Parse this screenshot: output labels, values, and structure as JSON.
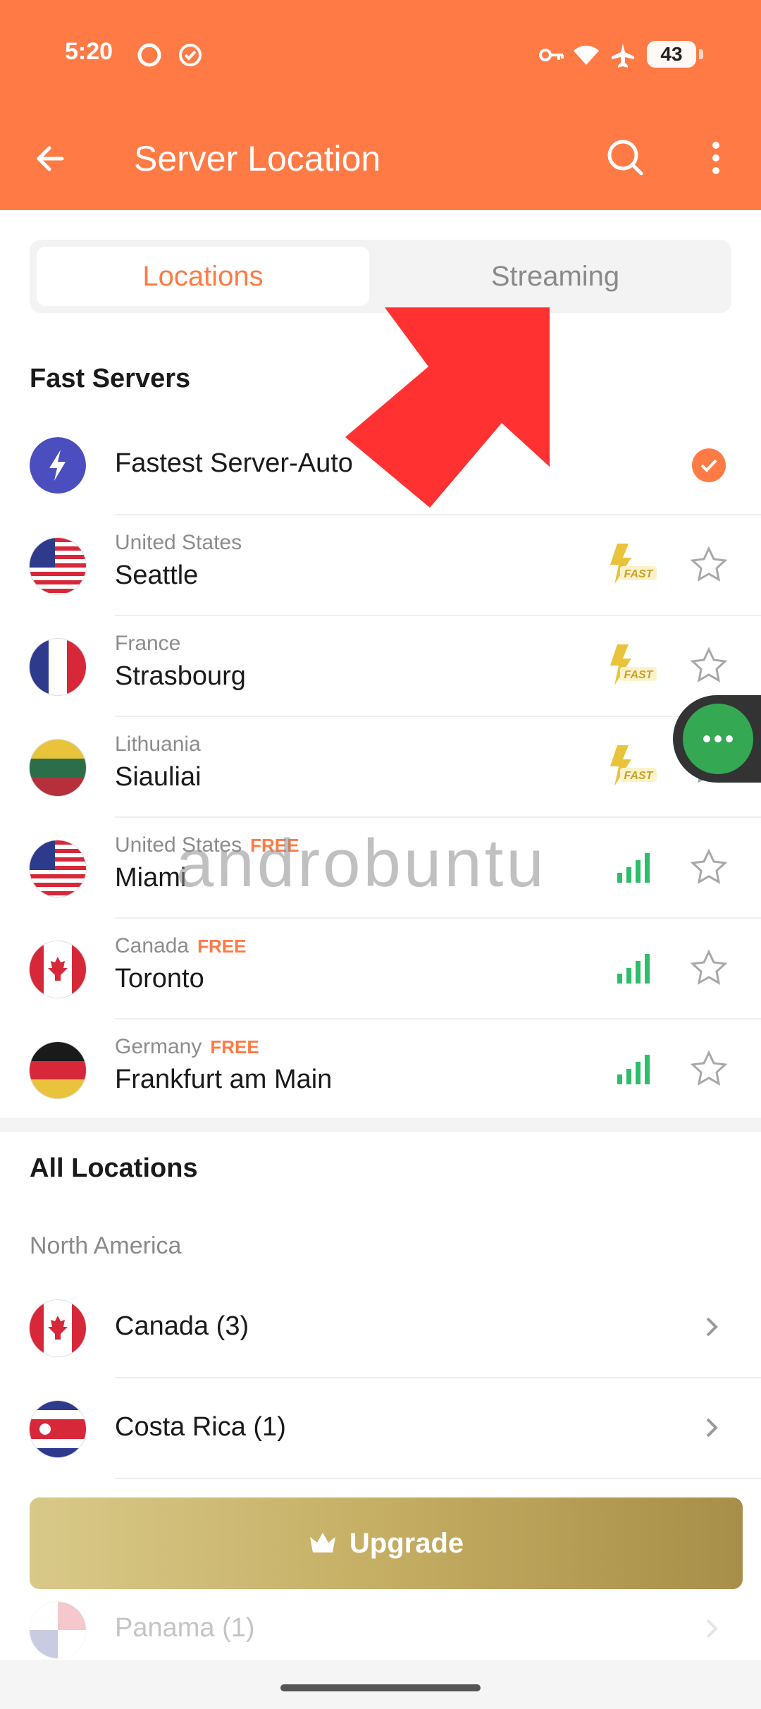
{
  "status_bar": {
    "time": "5:20",
    "battery": "43"
  },
  "header": {
    "title": "Server Location"
  },
  "tabs": [
    {
      "label": "Locations"
    },
    {
      "label": "Streaming"
    }
  ],
  "fast_servers": {
    "title": "Fast Servers",
    "auto": {
      "label": "Fastest Server-Auto"
    },
    "items": [
      {
        "country": "United States",
        "city": "Seattle",
        "free": ""
      },
      {
        "country": "France",
        "city": "Strasbourg",
        "free": ""
      },
      {
        "country": "Lithuania",
        "city": "Siauliai",
        "free": ""
      },
      {
        "country": "United States",
        "city": "Miami",
        "free": "FREE"
      },
      {
        "country": "Canada",
        "city": "Toronto",
        "free": "FREE"
      },
      {
        "country": "Germany",
        "city": "Frankfurt am Main",
        "free": "FREE"
      }
    ],
    "fast_badge": "FAST"
  },
  "all_locations": {
    "title": "All Locations",
    "region": "North America",
    "items": [
      {
        "label": "Canada (3)"
      },
      {
        "label": "Costa Rica (1)"
      },
      {
        "label": "Panama (1)"
      }
    ]
  },
  "upgrade": {
    "label": "Upgrade"
  },
  "watermark": "androbuntu",
  "colors": {
    "accent": "#FF7A45",
    "signal": "#2DBE6C",
    "fast": "#F2C94C"
  }
}
